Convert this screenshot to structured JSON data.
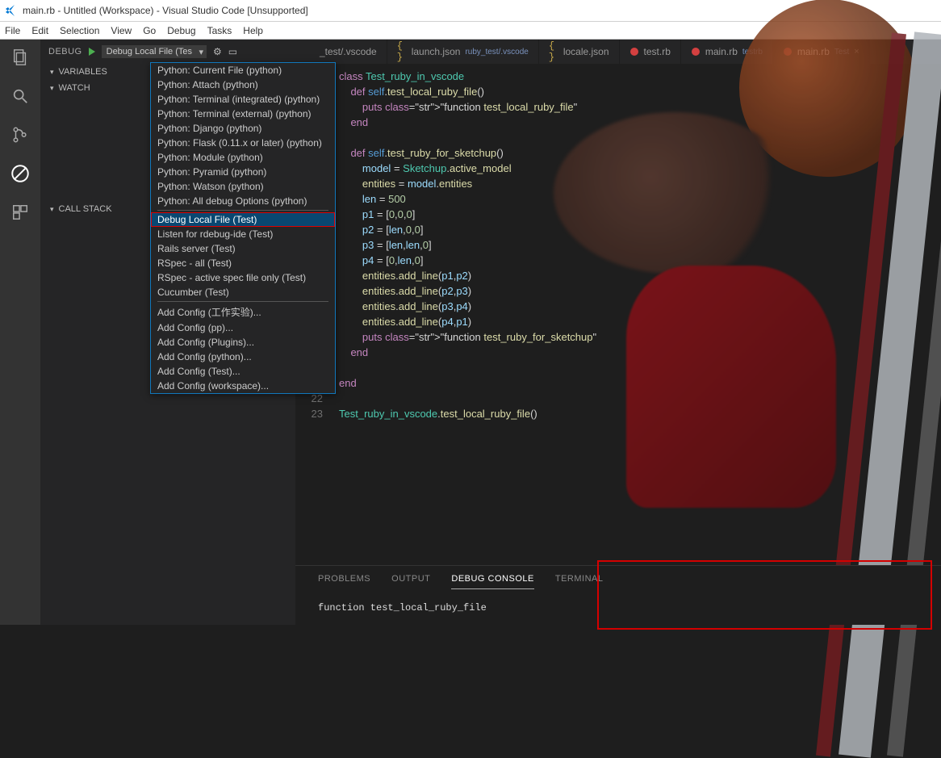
{
  "window": {
    "title": "main.rb - Untitled (Workspace) - Visual Studio Code [Unsupported]"
  },
  "menu": {
    "items": [
      "File",
      "Edit",
      "Selection",
      "View",
      "Go",
      "Debug",
      "Tasks",
      "Help"
    ]
  },
  "debug": {
    "label": "DEBUG",
    "selected": "Debug Local File (Tes",
    "dropdown": {
      "groups": [
        [
          "Python: Current File (python)",
          "Python: Attach (python)",
          "Python: Terminal (integrated) (python)",
          "Python: Terminal (external) (python)",
          "Python: Django (python)",
          "Python: Flask (0.11.x or later) (python)",
          "Python: Module (python)",
          "Python: Pyramid (python)",
          "Python: Watson (python)",
          "Python: All debug Options (python)"
        ],
        [
          "Debug Local File (Test)",
          "Listen for rdebug-ide (Test)",
          "Rails server (Test)",
          "RSpec - all (Test)",
          "RSpec - active spec file only (Test)",
          "Cucumber (Test)"
        ],
        [
          "Add Config (工作实验)...",
          "Add Config (pp)...",
          "Add Config (Plugins)...",
          "Add Config (python)...",
          "Add Config (Test)...",
          "Add Config (workspace)..."
        ]
      ],
      "selected": "Debug Local File (Test)"
    }
  },
  "sidebar": {
    "sections": [
      "VARIABLES",
      "WATCH",
      "CALL STACK"
    ]
  },
  "tabs": [
    {
      "label": "_test/.vscode",
      "kind": "plain"
    },
    {
      "label": "launch.json",
      "suffix": "ruby_test/.vscode",
      "kind": "json"
    },
    {
      "label": "locale.json",
      "kind": "json"
    },
    {
      "label": "test.rb",
      "kind": "ruby"
    },
    {
      "label": "main.rb",
      "suffix": "testrb",
      "kind": "ruby"
    },
    {
      "label": "main.rb",
      "suffix": "Test",
      "kind": "ruby",
      "active": true
    }
  ],
  "code": {
    "lines": [
      "class Test_ruby_in_vscode",
      "    def self.test_local_ruby_file()",
      "        puts \"function test_local_ruby_file\"",
      "    end",
      "",
      "    def self.test_ruby_for_sketchup()",
      "        model = Sketchup.active_model",
      "        entities = model.entities",
      "        len = 500",
      "        p1 = [0,0,0]",
      "        p2 = [len,0,0]",
      "        p3 = [len,len,0]",
      "        p4 = [0,len,0]",
      "        entities.add_line(p1,p2)",
      "        entities.add_line(p2,p3)",
      "        entities.add_line(p3,p4)",
      "        entities.add_line(p4,p1)",
      "        puts \"function test_ruby_for_sketchup\"",
      "    end",
      "",
      "end",
      "",
      "Test_ruby_in_vscode.test_local_ruby_file()"
    ]
  },
  "panel": {
    "tabs": [
      "PROBLEMS",
      "OUTPUT",
      "DEBUG CONSOLE",
      "TERMINAL"
    ],
    "active": "DEBUG CONSOLE",
    "output": "function test_local_ruby_file"
  }
}
